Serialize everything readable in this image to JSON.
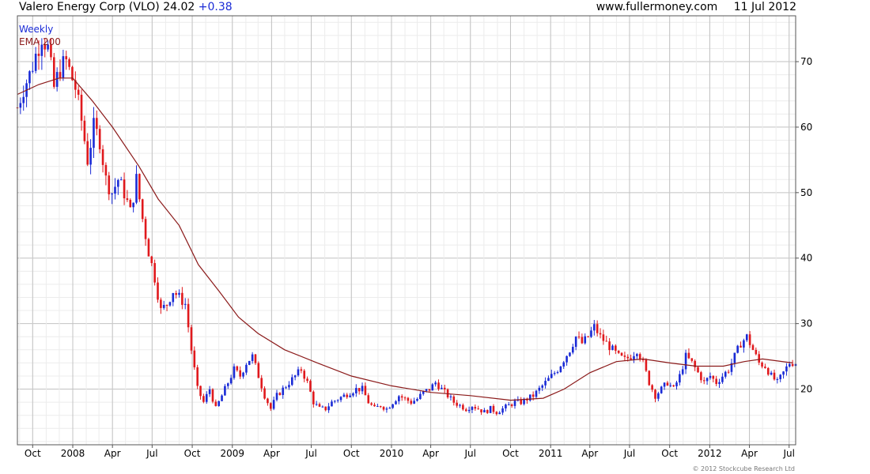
{
  "header": {
    "symbol_title": "Valero Energy Corp (VLO)",
    "last_price": "24.02",
    "change": "+0.38",
    "website": "www.fullermoney.com",
    "date": "11 Jul 2012"
  },
  "legend": {
    "weekly": "Weekly",
    "ema": "EMA 200"
  },
  "copyright": "© 2012 Stockcube Research Ltd",
  "chart_data": {
    "type": "candlestick",
    "title": "Valero Energy Corp (VLO)",
    "y_axis_side": "right",
    "ylim": [
      11.5,
      77
    ],
    "y_ticks": [
      20,
      30,
      40,
      50,
      60,
      70
    ],
    "x_range": [
      "2007-08-27",
      "2012-07-16"
    ],
    "grid": true,
    "x_ticks": [
      {
        "label": "Oct",
        "date": "2007-10-01"
      },
      {
        "label": "2008",
        "date": "2008-01-01"
      },
      {
        "label": "Apr",
        "date": "2008-04-01"
      },
      {
        "label": "Jul",
        "date": "2008-07-01"
      },
      {
        "label": "Oct",
        "date": "2008-10-01"
      },
      {
        "label": "2009",
        "date": "2009-01-01"
      },
      {
        "label": "Apr",
        "date": "2009-04-01"
      },
      {
        "label": "Jul",
        "date": "2009-07-01"
      },
      {
        "label": "Oct",
        "date": "2009-10-01"
      },
      {
        "label": "2010",
        "date": "2010-01-01"
      },
      {
        "label": "Apr",
        "date": "2010-04-01"
      },
      {
        "label": "Jul",
        "date": "2010-07-01"
      },
      {
        "label": "Oct",
        "date": "2010-10-01"
      },
      {
        "label": "2011",
        "date": "2011-01-01"
      },
      {
        "label": "Apr",
        "date": "2011-04-01"
      },
      {
        "label": "Jul",
        "date": "2011-07-01"
      },
      {
        "label": "Oct",
        "date": "2011-10-01"
      },
      {
        "label": "2012",
        "date": "2012-01-01"
      },
      {
        "label": "Apr",
        "date": "2012-04-01"
      },
      {
        "label": "Jul",
        "date": "2012-07-01"
      }
    ],
    "price_series": {
      "name": "Weekly",
      "points": [
        [
          "2007-08-27",
          63
        ],
        [
          "2007-09-10",
          66
        ],
        [
          "2007-09-24",
          68
        ],
        [
          "2007-10-08",
          71
        ],
        [
          "2007-10-22",
          74
        ],
        [
          "2007-11-05",
          72
        ],
        [
          "2007-11-19",
          66
        ],
        [
          "2007-12-03",
          69
        ],
        [
          "2007-12-17",
          70
        ],
        [
          "2008-01-07",
          66
        ],
        [
          "2008-01-21",
          61
        ],
        [
          "2008-02-04",
          55
        ],
        [
          "2008-02-18",
          60
        ],
        [
          "2008-03-03",
          58
        ],
        [
          "2008-03-17",
          52
        ],
        [
          "2008-03-31",
          50
        ],
        [
          "2008-04-14",
          52
        ],
        [
          "2008-04-28",
          50
        ],
        [
          "2008-05-12",
          47
        ],
        [
          "2008-05-26",
          52
        ],
        [
          "2008-06-09",
          46
        ],
        [
          "2008-06-23",
          41
        ],
        [
          "2008-07-07",
          37
        ],
        [
          "2008-07-21",
          32
        ],
        [
          "2008-08-04",
          33
        ],
        [
          "2008-08-18",
          35
        ],
        [
          "2008-09-01",
          34
        ],
        [
          "2008-09-15",
          33
        ],
        [
          "2008-09-29",
          26
        ],
        [
          "2008-10-13",
          20
        ],
        [
          "2008-10-27",
          18
        ],
        [
          "2008-11-10",
          20
        ],
        [
          "2008-11-24",
          17
        ],
        [
          "2008-12-08",
          19
        ],
        [
          "2008-12-22",
          21
        ],
        [
          "2009-01-05",
          23
        ],
        [
          "2009-01-19",
          22
        ],
        [
          "2009-02-02",
          24
        ],
        [
          "2009-02-16",
          25
        ],
        [
          "2009-03-02",
          22
        ],
        [
          "2009-03-16",
          19
        ],
        [
          "2009-03-30",
          17
        ],
        [
          "2009-04-13",
          19
        ],
        [
          "2009-04-27",
          20
        ],
        [
          "2009-05-11",
          21
        ],
        [
          "2009-05-25",
          22
        ],
        [
          "2009-06-08",
          23
        ],
        [
          "2009-06-22",
          21
        ],
        [
          "2009-07-06",
          18
        ],
        [
          "2009-07-20",
          17
        ],
        [
          "2009-08-03",
          17
        ],
        [
          "2009-08-17",
          18
        ],
        [
          "2009-08-31",
          18.5
        ],
        [
          "2009-09-14",
          19
        ],
        [
          "2009-09-28",
          19.5
        ],
        [
          "2009-10-12",
          20
        ],
        [
          "2009-10-26",
          20
        ],
        [
          "2009-11-09",
          18
        ],
        [
          "2009-11-23",
          17
        ],
        [
          "2009-12-07",
          17.5
        ],
        [
          "2009-12-21",
          17
        ],
        [
          "2010-01-04",
          18
        ],
        [
          "2010-01-18",
          19
        ],
        [
          "2010-02-01",
          18.5
        ],
        [
          "2010-02-15",
          18
        ],
        [
          "2010-03-01",
          18.5
        ],
        [
          "2010-03-15",
          19.5
        ],
        [
          "2010-03-29",
          20
        ],
        [
          "2010-04-12",
          21
        ],
        [
          "2010-04-26",
          20
        ],
        [
          "2010-05-10",
          19
        ],
        [
          "2010-05-24",
          18
        ],
        [
          "2010-06-07",
          17.5
        ],
        [
          "2010-06-21",
          17
        ],
        [
          "2010-07-05",
          17.5
        ],
        [
          "2010-07-19",
          17
        ],
        [
          "2010-08-02",
          16.5
        ],
        [
          "2010-08-16",
          17
        ],
        [
          "2010-08-30",
          16.5
        ],
        [
          "2010-09-13",
          17
        ],
        [
          "2010-09-27",
          17.5
        ],
        [
          "2010-10-11",
          18
        ],
        [
          "2010-10-25",
          18
        ],
        [
          "2010-11-08",
          18.5
        ],
        [
          "2010-11-22",
          19
        ],
        [
          "2010-12-06",
          20
        ],
        [
          "2010-12-20",
          21
        ],
        [
          "2011-01-03",
          22
        ],
        [
          "2011-01-17",
          23
        ],
        [
          "2011-01-31",
          24.5
        ],
        [
          "2011-02-14",
          26
        ],
        [
          "2011-02-28",
          28
        ],
        [
          "2011-03-14",
          27
        ],
        [
          "2011-03-28",
          28
        ],
        [
          "2011-04-11",
          29.5
        ],
        [
          "2011-04-25",
          28
        ],
        [
          "2011-05-09",
          27
        ],
        [
          "2011-05-23",
          26
        ],
        [
          "2011-06-06",
          25
        ],
        [
          "2011-06-20",
          24.5
        ],
        [
          "2011-07-04",
          25
        ],
        [
          "2011-07-18",
          26
        ],
        [
          "2011-08-01",
          24
        ],
        [
          "2011-08-15",
          21
        ],
        [
          "2011-08-29",
          19
        ],
        [
          "2011-09-12",
          20
        ],
        [
          "2011-09-26",
          21
        ],
        [
          "2011-10-10",
          20
        ],
        [
          "2011-10-24",
          22
        ],
        [
          "2011-11-07",
          25
        ],
        [
          "2011-11-21",
          24
        ],
        [
          "2011-12-05",
          22.5
        ],
        [
          "2011-12-19",
          21
        ],
        [
          "2012-01-02",
          22
        ],
        [
          "2012-01-16",
          21
        ],
        [
          "2012-01-30",
          22
        ],
        [
          "2012-02-13",
          23
        ],
        [
          "2012-02-27",
          25
        ],
        [
          "2012-03-12",
          27
        ],
        [
          "2012-03-26",
          28
        ],
        [
          "2012-04-09",
          26
        ],
        [
          "2012-04-23",
          24
        ],
        [
          "2012-05-07",
          23.5
        ],
        [
          "2012-05-21",
          22
        ],
        [
          "2012-06-04",
          21
        ],
        [
          "2012-06-18",
          22.5
        ],
        [
          "2012-07-02",
          24
        ],
        [
          "2012-07-09",
          24.02
        ]
      ]
    },
    "ema_series": {
      "name": "EMA 200",
      "color": "#8b1a1a",
      "points": [
        [
          "2007-08-27",
          65
        ],
        [
          "2007-10-15",
          66.5
        ],
        [
          "2007-12-01",
          67.5
        ],
        [
          "2008-01-01",
          67.5
        ],
        [
          "2008-02-15",
          64
        ],
        [
          "2008-04-01",
          60
        ],
        [
          "2008-06-01",
          54
        ],
        [
          "2008-07-15",
          49
        ],
        [
          "2008-09-01",
          45
        ],
        [
          "2008-10-15",
          39
        ],
        [
          "2008-12-01",
          35
        ],
        [
          "2009-01-15",
          31
        ],
        [
          "2009-03-01",
          28.5
        ],
        [
          "2009-05-01",
          26
        ],
        [
          "2009-07-15",
          24
        ],
        [
          "2009-10-01",
          22
        ],
        [
          "2010-01-01",
          20.5
        ],
        [
          "2010-04-01",
          19.5
        ],
        [
          "2010-07-01",
          19
        ],
        [
          "2010-10-01",
          18.3
        ],
        [
          "2010-12-15",
          18.6
        ],
        [
          "2011-02-01",
          20
        ],
        [
          "2011-04-01",
          22.5
        ],
        [
          "2011-06-01",
          24.2
        ],
        [
          "2011-08-01",
          24.6
        ],
        [
          "2011-10-01",
          24
        ],
        [
          "2011-12-01",
          23.5
        ],
        [
          "2012-02-01",
          23.5
        ],
        [
          "2012-03-20",
          24.2
        ],
        [
          "2012-05-01",
          24.6
        ],
        [
          "2012-07-09",
          24
        ]
      ]
    },
    "colors": {
      "up_candle": "#1a2bd6",
      "down_candle": "#e0191d",
      "ema_line": "#8b1a1a",
      "grid": "#d2d2d2",
      "frame": "#555555"
    }
  }
}
